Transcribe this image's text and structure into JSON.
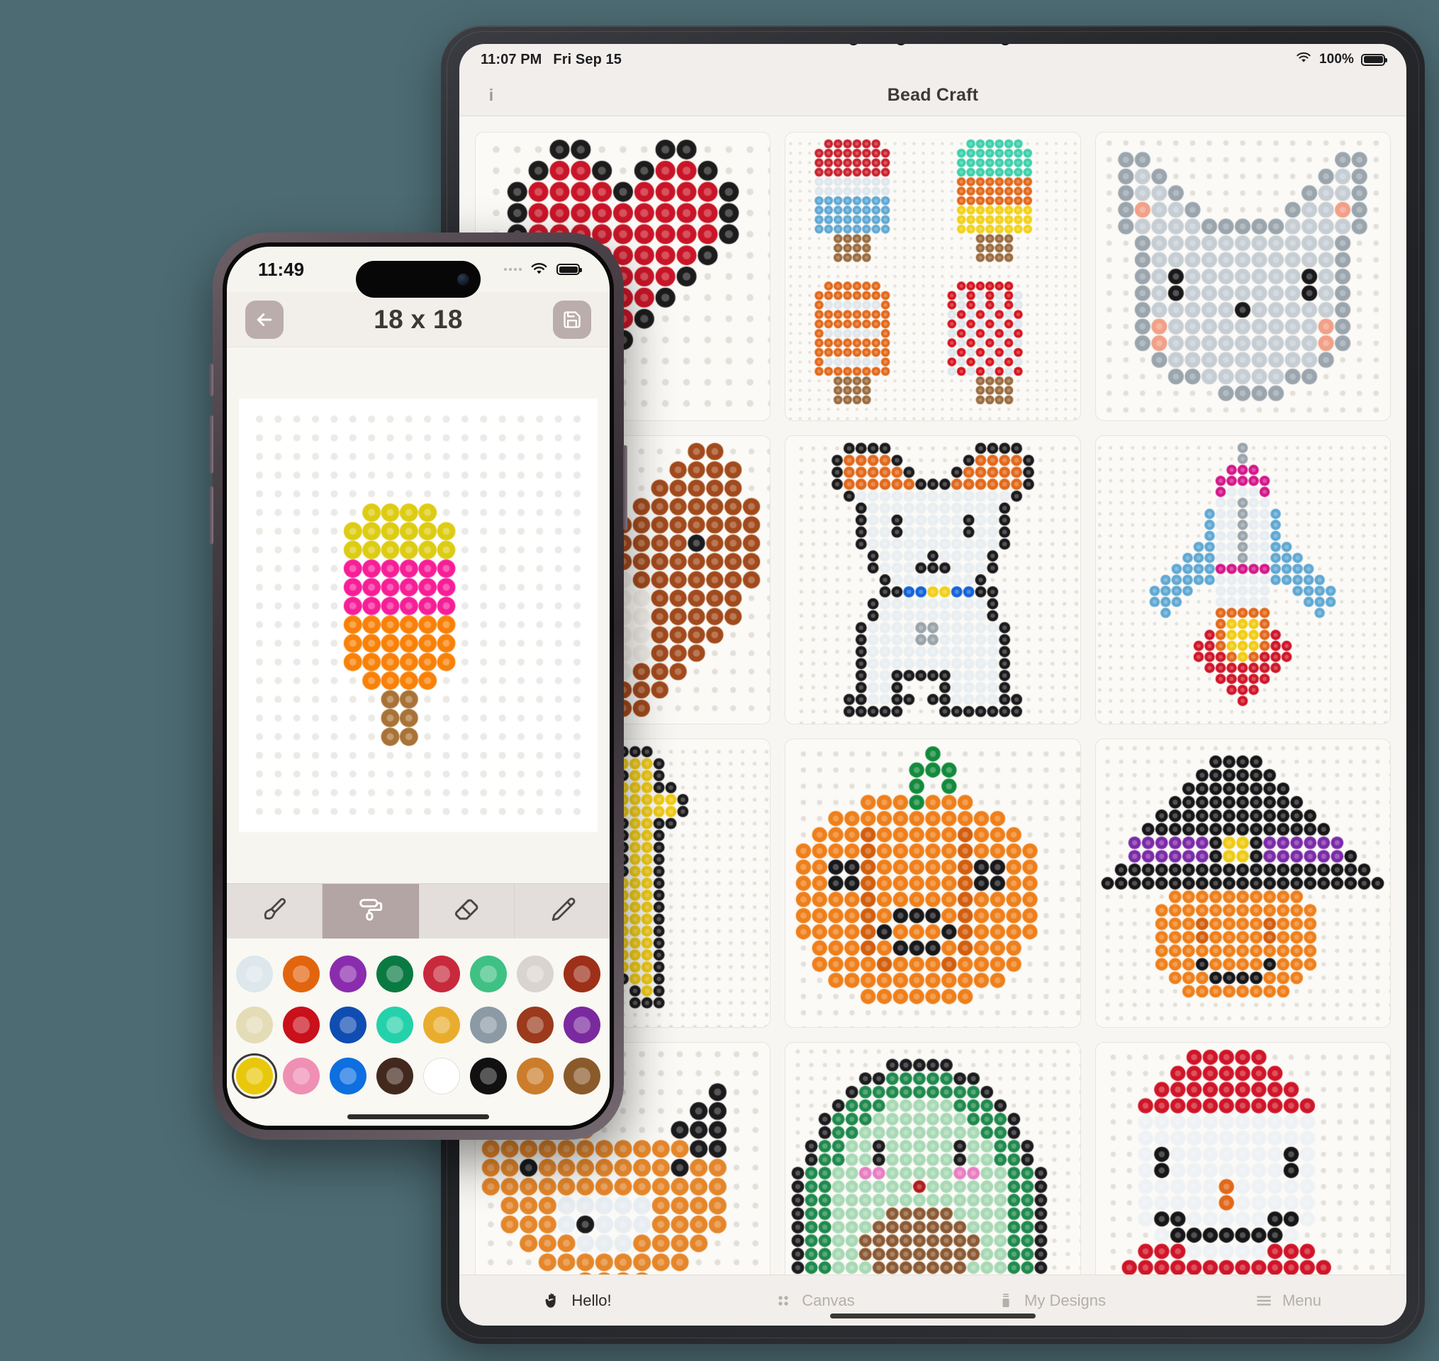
{
  "ipad": {
    "status": {
      "time": "11:07 PM",
      "date": "Fri Sep 15",
      "battery_percent": "100%",
      "wifi_icon": "wifi-icon"
    },
    "navbar": {
      "title": "Bead Craft",
      "info_label": "i",
      "info_icon": "info-icon"
    },
    "tabbar": [
      {
        "id": "hello",
        "label": "Hello!",
        "icon": "waving-hand-icon",
        "active": true
      },
      {
        "id": "canvas",
        "label": "Canvas",
        "icon": "grid-dots-icon",
        "active": false
      },
      {
        "id": "my-designs",
        "label": "My Designs",
        "icon": "save-designs-icon",
        "active": false
      },
      {
        "id": "menu",
        "label": "Menu",
        "icon": "hamburger-menu-icon",
        "active": false
      }
    ],
    "gallery": {
      "cells": [
        {
          "name": "heart-design",
          "pattern": "heart"
        },
        {
          "name": "popsicles-design",
          "pattern": "popsicles"
        },
        {
          "name": "cat-face-design",
          "pattern": "catface"
        },
        {
          "name": "fox-design",
          "pattern": "fox"
        },
        {
          "name": "dog-design",
          "pattern": "dog"
        },
        {
          "name": "rocket-design",
          "pattern": "rocket"
        },
        {
          "name": "giraffe-design",
          "pattern": "giraffe"
        },
        {
          "name": "pumpkin-design",
          "pattern": "pumpkin"
        },
        {
          "name": "witch-hat-design",
          "pattern": "witch"
        },
        {
          "name": "fox-bottom-design",
          "pattern": "foxbottom"
        },
        {
          "name": "avocado-design",
          "pattern": "avocado"
        },
        {
          "name": "santa-design",
          "pattern": "santa"
        }
      ]
    }
  },
  "iphone": {
    "status": {
      "time": "11:49",
      "signal_icon": "signal-dots-icon",
      "wifi_icon": "wifi-icon",
      "battery_icon": "battery-full-icon"
    },
    "navbar": {
      "title": "18 x 18",
      "back_icon": "back-arrow-icon",
      "save_icon": "floppy-save-icon"
    },
    "toolbar": [
      {
        "id": "brush",
        "icon": "paintbrush-icon",
        "label": "Brush",
        "active": false
      },
      {
        "id": "fill",
        "icon": "paint-roller-icon",
        "label": "Fill",
        "active": true
      },
      {
        "id": "eraser",
        "icon": "eraser-icon",
        "label": "Eraser",
        "active": false
      },
      {
        "id": "pencil",
        "icon": "pencil-icon",
        "label": "Pencil",
        "active": false
      }
    ],
    "palette": {
      "selected_index": 16,
      "colors": [
        "#dde7ec",
        "#e2650e",
        "#8a2cae",
        "#0a7a42",
        "#c8293c",
        "#3fc184",
        "#d9d4d0",
        "#9e2f18",
        "#e4dcb6",
        "#c9101b",
        "#0f4db3",
        "#25d1ab",
        "#e9ad2e",
        "#8b9aa5",
        "#9b3a1c",
        "#7a2a9e",
        "#e9c80b",
        "#ef8fb4",
        "#0d6fe0",
        "#43291d",
        "#ffffff",
        "#111111",
        "#cb7d2c",
        "#8a5a2b"
      ]
    },
    "canvas": {
      "grid_label": "18 x 18",
      "pattern": "popsicle-phone"
    }
  },
  "patterns": {
    "popsicle-phone": {
      "cols": 18,
      "rows": 22,
      "palette": {
        "Y": "#ddcc12",
        "M": "#f71e97",
        "O": "#f98108",
        "B": "#a97236",
        "-": null
      },
      "rows_data": [
        "------------------",
        "------------------",
        "------------------",
        "------------------",
        "------------------",
        "------YYYY--------",
        "-----YYYYYY-------",
        "-----YYYYYY-------",
        "-----MMMMMM-------",
        "-----MMMMMM-------",
        "-----MMMMMM-------",
        "-----OOOOOO-------",
        "-----OOOOOO-------",
        "-----OOOOOO-------",
        "------OOOO--------",
        "-------BB---------",
        "-------BB---------",
        "-------BB---------",
        "------------------",
        "------------------",
        "------------------",
        "------------------"
      ]
    },
    "heart": {
      "cols": 13,
      "rows": 13,
      "palette": {
        "R": "#c91527",
        "D": "#8c0f1c",
        "K": "#1c1c1c",
        "-": null
      },
      "rows_data": [
        "---KK---KK---",
        "--KRRK-KRRK--",
        "-KRRRRKRRRRK-",
        "-KRRRRRRRRRK-",
        "-KRRRRRRRRRK-",
        "--KRRRRRRRK--",
        "---KRRRRRK---",
        "----KRRRK----",
        "-----KRK-----",
        "------K------",
        "-------------",
        "-------------",
        "-------------"
      ]
    },
    "popsicles": {
      "cols": 29,
      "rows": 29,
      "palette": {
        "R": "#c9202c",
        "W": "#dfe7ec",
        "B": "#5fa8d3",
        "N": "#9a6b3f",
        "T": "#3bd0ab",
        "O": "#e2681a",
        "Y": "#f2d118",
        "r": "#d5131e",
        "-": null
      },
      "rows_data": [
        "---RRRRRR---------TTTTTT-----",
        "--RRRRRRRR-------TTTTTTTT----",
        "--RRRRRRRR-------TTTTTTTT----",
        "--RRRRRRRR-------TTTTTTTT----",
        "--WWWWWWWW-------OOOOOOOO----",
        "--WWWWWWWW-------OOOOOOOO----",
        "--BBBBBBBB-------OOOOOOOO----",
        "--BBBBBBBB-------YYYYYYYY----",
        "--BBBBBBBB-------YYYYYYYY----",
        "--BBBBBBBB-------YYYYYYYY----",
        "----NNNN-----------NNNN------",
        "----NNNN-----------NNNN------",
        "----NNNN-----------NNNN------",
        "-----------------------------",
        "-----------------------------",
        "---OOOOOO--------rrrrrr------",
        "--OOOOOOOO------rWrWrWrW-----",
        "--OWWWWWWO------rWrWrWrW-----",
        "--OOOOOOOO------WrWrWrWr-----",
        "--OOOOOOOO------rWrWrWrW-----",
        "--OWWWWWWO------WrWrWrWr-----",
        "--OOOOOOOO------rWrWrWrW-----",
        "--OOOOOOOO------WrWrWrWr-----",
        "--OWWWWWWO------rWrWrWrW-----",
        "--OOOOOOOO------WrWrWrWr-----",
        "----NNNN-----------NNNN------",
        "----NNNN-----------NNNN------",
        "----NNNN-----------NNNN------",
        "-----------------------------"
      ]
    },
    "catface": {
      "cols": 17,
      "rows": 15,
      "palette": {
        "G": "#9aa5ad",
        "L": "#c6ced4",
        "W": "#e7edf1",
        "P": "#f2a088",
        "K": "#19191b",
        "-": null
      },
      "rows_data": [
        "-GG-----------GG-",
        "-GLG---------GLG-",
        "-GLLG-------GLLG-",
        "-GPLLG-----GLLPG-",
        "-GLLLLGGGGGLLLLG-",
        "--GLLLLLLLLLLLG--",
        "--GLLLLLLLLLLLG--",
        "--GLKLLLLLLLKLG--",
        "--GLKLLLLLLLKLG--",
        "--GLLLLLKLLLLLG--",
        "--GPLLLLLLLLLPG--",
        "--GPLLLLLLLLLPG--",
        "---GLLLLLLLLLG---",
        "----GGLLLLLGG----",
        "-------GGGG------"
      ]
    },
    "fox": {
      "cols": 15,
      "rows": 15,
      "palette": {
        "O": "#e5862a",
        "D": "#a24a1c",
        "W": "#f0ece6",
        "K": "#1b1b1d",
        "-": null
      },
      "rows_data": [
        "--OO-------DD--",
        "-OOOO-----DDDD-",
        "-OOOOO---DDDDD-",
        "OOOOOOO-DDDDDDD",
        "OOOOOOODDDDDDDD",
        "OOOKOOODDDDKDDD",
        "OOOOOOODDDDDDDD",
        "OOOOOOWWDDDDDDD",
        "-OOOOWWWWDDDDD-",
        "-OOOOWKWWDDDDD-",
        "--OOOWWWWDDDD--",
        "---OOOWWWDDD---",
        "----OOOWDDD----",
        "-----OODDD-----",
        "------ODD------"
      ]
    },
    "dog": {
      "cols": 21,
      "rows": 23,
      "palette": {
        "K": "#1a1a1c",
        "W": "#e9eef1",
        "G": "#9aa4ab",
        "O": "#e2681a",
        "B": "#1463d8",
        "Y": "#f0d01b",
        "-": null
      },
      "rows_data": [
        "---KKKK-------KKKK---",
        "--KOOOOK-----KOOOOK--",
        "--KOOOOOK---KOOOOOK--",
        "--KOOOOOOKKKOOOOOOK--",
        "---KWWWWWWWWWWWWWK---",
        "----KWWWWWWWWWWWK----",
        "----KWWKWWWWWKWWK----",
        "----KWWKWWWWWKWWK----",
        "----KWWWWWWWWWWWK----",
        "-----KWWWWKWWWWK-----",
        "-----KWWWKKKWWWK-----",
        "------KWWWWWWWK------",
        "------KKBBYYBBKK-----",
        "-----KWWWWWWWWWK-----",
        "-----KWWWWWWWWWK-----",
        "----KWWWWGGWWWWWK----",
        "----KWWWWGGWWWWWK----",
        "----KWWWWWWWWWWWK----",
        "----KWWWWWWWWWWWK----",
        "----KWWKKKKKWWWWK----",
        "----KWWK---KWWWWK----",
        "---KKWWKK-KKWWWWKK---",
        "---KKKKK---KKKKKKK---"
      ]
    },
    "rocket": {
      "cols": 19,
      "rows": 25,
      "palette": {
        "G": "#9aa4ab",
        "C": "#d4178a",
        "W": "#e7edf1",
        "B": "#5fa8d3",
        "R": "#d01528",
        "Y": "#f2cc12",
        "O": "#e2681a",
        "-": null
      },
      "rows_data": [
        "---------G---------",
        "---------G---------",
        "--------CCC--------",
        "-------CCCCC-------",
        "-------CWWWC-------",
        "-------WWGWW-------",
        "------BWWGWWB------",
        "------BWWGWWB------",
        "------BWWGWWB------",
        "-----BBWWGWWBB-----",
        "----BBBWWGWWBBB----",
        "---BBBBCCCCCBBBB---",
        "--BBBBBWWWWWBBBBB--",
        "-BBBB--WWWWW--BBBB-",
        "-BBB---WWWWW---BBB-",
        "--B----OOOOO----B--",
        "-------OYYYO-------",
        "------ROYYYOR------",
        "-----RROYYYORR-----",
        "-----RRROYORRR-----",
        "------RRRRRRR------",
        "-------RRRRR-------",
        "--------RRR--------",
        "---------R---------",
        "-------------------"
      ]
    },
    "giraffe": {
      "cols": 15,
      "rows": 23,
      "palette": {
        "Y": "#f0cb14",
        "K": "#1b1b1d",
        "-": null
      },
      "rows_data": [
        "------KKKK-----",
        "-----KYYYYK----",
        "-----KYKYYK----",
        "-----KYYYYKK---",
        "-----KYYYYYYK--",
        "------KYYYYYK--",
        "------KKYYKK---",
        "-------KYYK----",
        "-------KYYK----",
        "-------KYYK----",
        "-------KYYK----",
        "------KYYYK----",
        "-----KYYYYK----",
        "-----KYYYYK----",
        "----KYYYYYK----",
        "----KYYYYYK----",
        "----KYYYYYK----",
        "----KYYYYYK----",
        "----KYYYYYK----",
        "----KYKKYYK----",
        "----KYK-KYK----",
        "----KKK-KKK----",
        "---------------"
      ]
    },
    "pumpkin": {
      "cols": 17,
      "rows": 17,
      "palette": {
        "O": "#ef7f1a",
        "D": "#d35e0d",
        "G": "#138a3c",
        "K": "#18181a",
        "-": null
      },
      "rows_data": [
        "--------G--------",
        "-------GGG-------",
        "-------G-G-------",
        "----OOOGOOO------",
        "--OOOOOOOOOOO----",
        "-OOODOOOOODOOO---",
        "OOOODOOOOODOOOO--",
        "OOKKDOOOOODKKOO--",
        "OOKKDOOOOODKKOO--",
        "OOOODOOOOODOOOO--",
        "OOOODOKKKODOOOO--",
        "OOOODKOOOKDOOOO--",
        "-OOODOKKKODOOO---",
        "-OOOODOOODOOOO---",
        "--OOOOOOOOOOO----",
        "----OOOOOOO------",
        "-----------------"
      ]
    },
    "witch": {
      "cols": 21,
      "rows": 19,
      "palette": {
        "K": "#161618",
        "P": "#7b2aa8",
        "Y": "#f0cb14",
        "O": "#ef7f1a",
        "D": "#d35e0d",
        "-": null
      },
      "rows_data": [
        "--------KKKK---------",
        "-------KKKKKK--------",
        "------KKKKKKKK-------",
        "-----KKKKKKKKKK------",
        "----KKKKKKKKKKKK-----",
        "---KKKKKKKKKKKKKK----",
        "--PPPPPPKYYKPPPPPP---",
        "--PPPPPPKYYKPPPPPPK--",
        "-KKKKKKKKKKKKKKKKKKK-",
        "KKKKKKKKKKKKKKKKKKKKK",
        "-----OOOOOOOOOO------",
        "----OOOOOOOOOOOO-----",
        "----OOODOOOODOOO-----",
        "----OOODOOOODOOO-----",
        "----OOOOOOOOOOOO-----",
        "----OOOKOOOOKOOO-----",
        "-----OOOKKKKOOO------",
        "------OOOOOOOO-------",
        "---------------------"
      ]
    },
    "foxbottom": {
      "cols": 15,
      "rows": 11,
      "palette": {
        "O": "#e5862a",
        "D": "#c25c1c",
        "W": "#e7edf1",
        "K": "#1b1b1d",
        "-": null
      },
      "rows_data": [
        "--OO--------K--",
        "-OOOO------KK--",
        "OOOOOO----KKK--",
        "OOOOOOOOOOOKK--",
        "OOKOOOOOOOKOO--",
        "OOOOOOOOOOOOO--",
        "-OOOWWWWWOOOO--",
        "-OOOWKWWWOOOO--",
        "--OOOWWWOOOO---",
        "---OOOOOOOO----",
        "-----OOOO------"
      ]
    },
    "avocado": {
      "cols": 21,
      "rows": 19,
      "palette": {
        "K": "#1c1c1e",
        "G": "#1f8a4d",
        "L": "#a8d9b5",
        "N": "#8b5a34",
        "P": "#e87ec4",
        "R": "#b01c1c",
        "-": null
      },
      "rows_data": [
        "-------KKKKK---------",
        "-----KKGGGGGKK-------",
        "----KGGGGGGGGGK------",
        "---KGGGLLLLLGGGK-----",
        "--KGGGLLLLLLLGGGK----",
        "--KGGLLLLLLLLLGGK----",
        "-KGGLLKLLLLLKLLGGK---",
        "-KGGLLKLLLLLKLLGGK---",
        "KGGLLPPLLLLLPPLLGGK--",
        "KGGLLLLLLRLLLLLLGGK--",
        "KGGLLLLLLLLLLLLLGGK--",
        "KGGLLLLNNNNNLLLLGGK--",
        "KGGLLLNNNNNNNLLLGGK--",
        "KGGLLNNNNNNNNNLLGGK--",
        "KGGLLNNNNNNNNNLLGGK--",
        "KGGLLLNNNNNNNLLLGGK--",
        "-KGGLLLNNNNNLLLGGK---",
        "--KKGGGLLLLLGGGKK----",
        "----KKKGGGGGKKK------"
      ]
    },
    "santa": {
      "cols": 17,
      "rows": 17,
      "palette": {
        "R": "#d01528",
        "W": "#eef2f5",
        "K": "#161618",
        "O": "#e2681a",
        "-": null
      },
      "rows_data": [
        "-----RRRRR-------",
        "----RRRRRRR------",
        "---RRRRRRRRR-----",
        "--RRRRRRRRRRR----",
        "--WWWWWWWWWWW----",
        "--WWWWWWWWWWW----",
        "--WKWWWWWWWKW----",
        "--WKWWWWWWWKW----",
        "--WWWWWOWWWWW----",
        "--WWWWWOWWWWW----",
        "--WKKWWWWWKKW----",
        "---WKKKKKKKW-----",
        "--RRRWWWWWRRR----",
        "-RRRRRRRRRRRRR---",
        "RRRRKRRRRRKRRRR--",
        "RRRRKRRRRRKRRRR--",
        "-RRRRRRRRRRRRR---"
      ]
    }
  }
}
